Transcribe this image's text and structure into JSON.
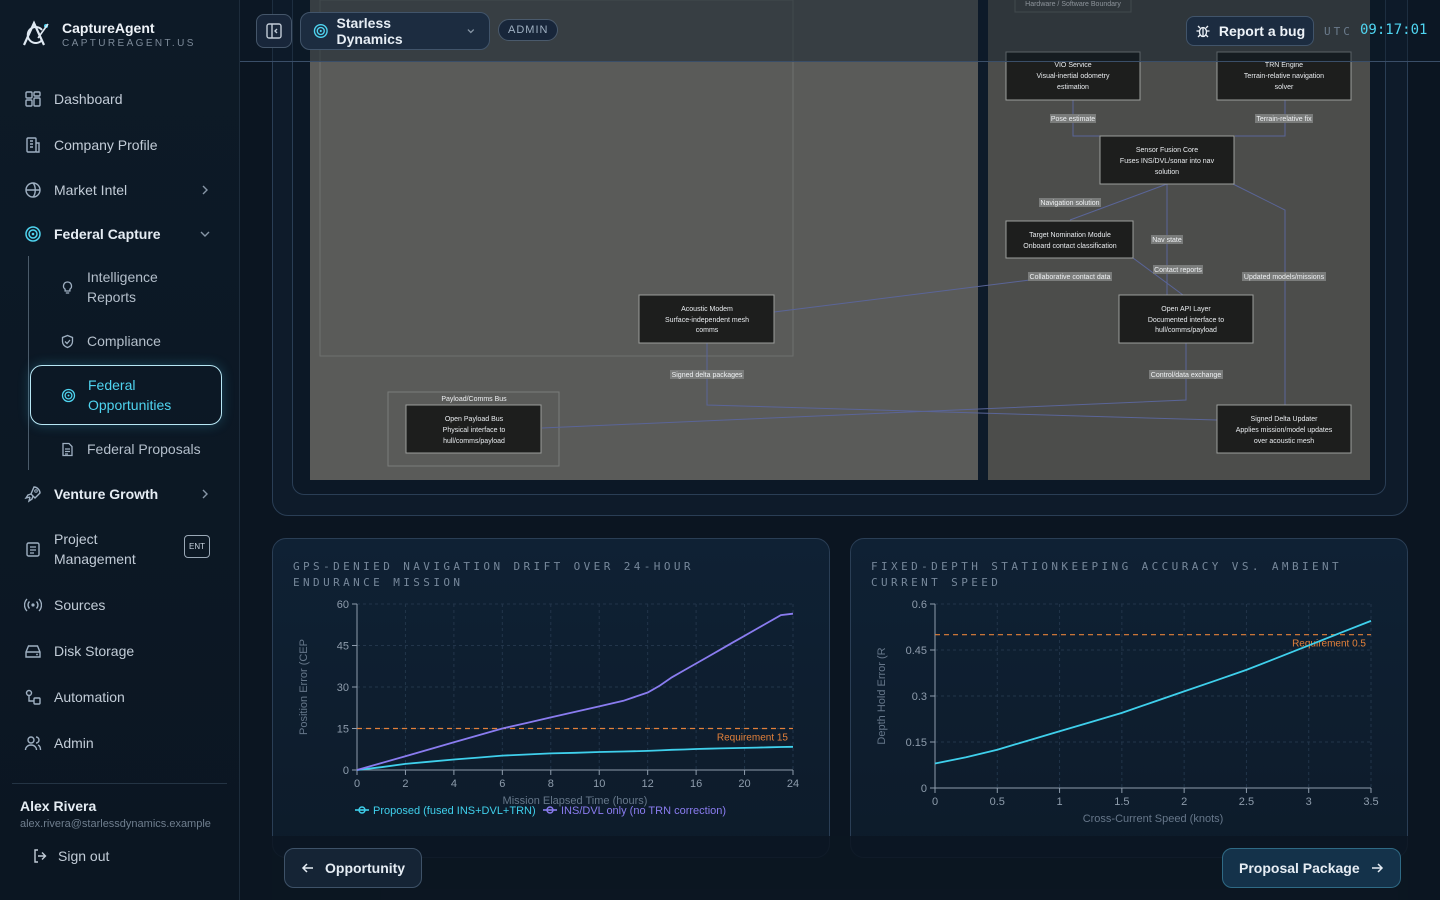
{
  "brand": {
    "name": "CaptureAgent",
    "domain": "CAPTUREAGENT.US"
  },
  "sidebar": {
    "items": [
      {
        "label": "Dashboard",
        "icon": "grid-icon"
      },
      {
        "label": "Company Profile",
        "icon": "building-icon"
      },
      {
        "label": "Market Intel",
        "icon": "globe-icon"
      },
      {
        "label": "Federal Capture",
        "icon": "target-icon"
      },
      {
        "label": "Venture Growth",
        "icon": "rocket-icon"
      },
      {
        "label": "Project Management",
        "icon": "clipboard-icon",
        "badge": "ENT"
      },
      {
        "label": "Sources",
        "icon": "broadcast-icon"
      },
      {
        "label": "Disk Storage",
        "icon": "drive-icon"
      },
      {
        "label": "Automation",
        "icon": "workflow-icon"
      },
      {
        "label": "Admin",
        "icon": "users-icon"
      }
    ],
    "sub_items": [
      {
        "label": "Intelligence Reports",
        "icon": "lightbulb-icon"
      },
      {
        "label": "Compliance",
        "icon": "shield-icon"
      },
      {
        "label": "Federal Opportunities",
        "icon": "target-icon",
        "active": true
      },
      {
        "label": "Federal Proposals",
        "icon": "document-icon"
      }
    ],
    "user": {
      "name": "Alex Rivera",
      "email": "alex.rivera@starlessdynamics.example"
    },
    "sign_out": "Sign out"
  },
  "topbar": {
    "org": "Starless Dynamics",
    "role_badge": "ADMIN",
    "report_bug": "Report a bug",
    "utc_label": "UTC",
    "utc_time": "09:17:01"
  },
  "diagram": {
    "boundary_label": "Hardware / Software Boundary",
    "nodes": {
      "vio": [
        "VIO Service",
        "Visual-inertial odometry",
        "estimation"
      ],
      "trn": [
        "TRN Engine",
        "Terrain-relative navigation",
        "solver"
      ],
      "fusion": [
        "Sensor Fusion Core",
        "Fuses INS/DVL/sonar into nav",
        "solution"
      ],
      "target": [
        "Target Nomination Module",
        "Onboard contact classification"
      ],
      "modem": [
        "Acoustic Modem",
        "Surface-independent mesh",
        "comms"
      ],
      "api": [
        "Open API Layer",
        "Documented interface to",
        "hull/comms/payload"
      ],
      "payload": [
        "Open Payload Bus",
        "Physical interface to",
        "hull/comms/payload"
      ],
      "updater": [
        "Signed Delta Updater",
        "Applies mission/model updates",
        "over acoustic mesh"
      ]
    },
    "group_label": "Payload/Comms Bus",
    "edges": [
      "Pose estimate",
      "Terrain-relative fix",
      "Navigation solution",
      "Nav state",
      "Contact reports",
      "Collaborative contact data",
      "Updated models/missions",
      "Signed delta packages",
      "Control/data exchange"
    ]
  },
  "chart_data": [
    {
      "type": "line",
      "title": "GPS-DENIED NAVIGATION DRIFT OVER 24-HOUR ENDURANCE MISSION",
      "xlabel": "Mission Elapsed Time (hours)",
      "ylabel": "Position Error (CEP",
      "xlim": [
        0,
        24
      ],
      "ylim": [
        0,
        60
      ],
      "xticks": [
        0,
        2,
        4,
        6,
        8,
        10,
        12,
        16,
        20,
        24
      ],
      "yticks": [
        0,
        15,
        30,
        45,
        60
      ],
      "grid": true,
      "reference": {
        "value": 15,
        "label": "Requirement 15",
        "color": "#e2803a"
      },
      "legend_placement": "bottom",
      "series": [
        {
          "name": "Proposed (fused INS+DVL+TRN)",
          "color": "#3fd0ec",
          "x": [
            0,
            1,
            2,
            3,
            4,
            5,
            6,
            7,
            8,
            9,
            10,
            11,
            12,
            13,
            14,
            15,
            16,
            17,
            18,
            19,
            20,
            21,
            22,
            23,
            24
          ],
          "y": [
            0,
            1,
            2.2,
            3,
            3.8,
            4.5,
            5.2,
            5.6,
            6,
            6.2,
            6.5,
            6.7,
            6.9,
            7.1,
            7.3,
            7.4,
            7.6,
            7.7,
            7.8,
            7.9,
            8,
            8.1,
            8.2,
            8.3,
            8.4
          ]
        },
        {
          "name": "INS/DVL only (no TRN correction)",
          "color": "#8a7cf0",
          "x": [
            0,
            1,
            2,
            3,
            4,
            5,
            6,
            7,
            8,
            9,
            10,
            11,
            12,
            13,
            14,
            15,
            16,
            17,
            18,
            19,
            20,
            21,
            22,
            23,
            24
          ],
          "y": [
            0,
            2.5,
            5,
            7.5,
            10,
            12.5,
            15,
            17,
            19,
            21,
            23,
            25,
            28,
            30.5,
            33.5,
            36,
            38.5,
            41,
            43.5,
            46,
            48.5,
            51,
            53.5,
            56,
            56.5
          ]
        }
      ]
    },
    {
      "type": "line",
      "title": "FIXED-DEPTH STATIONKEEPING ACCURACY VS. AMBIENT CURRENT SPEED",
      "xlabel": "Cross-Current Speed (knots)",
      "ylabel": "Depth Hold Error (R",
      "xlim": [
        0,
        3.5
      ],
      "ylim": [
        0,
        0.6
      ],
      "xticks": [
        0,
        0.5,
        1,
        1.5,
        2,
        2.5,
        3,
        3.5
      ],
      "yticks": [
        0,
        0.15,
        0.3,
        0.45,
        0.6
      ],
      "grid": true,
      "reference": {
        "value": 0.5,
        "label": "Requirement 0.5",
        "color": "#e2803a"
      },
      "series": [
        {
          "name": "",
          "color": "#3fd0ec",
          "x": [
            0,
            0.25,
            0.5,
            0.75,
            1,
            1.25,
            1.5,
            1.75,
            2,
            2.25,
            2.5,
            2.75,
            3,
            3.25,
            3.5
          ],
          "y": [
            0.08,
            0.1,
            0.125,
            0.155,
            0.185,
            0.215,
            0.245,
            0.28,
            0.315,
            0.35,
            0.385,
            0.425,
            0.465,
            0.505,
            0.545
          ]
        }
      ]
    }
  ],
  "footer": {
    "back": "Opportunity",
    "next": "Proposal Package"
  }
}
